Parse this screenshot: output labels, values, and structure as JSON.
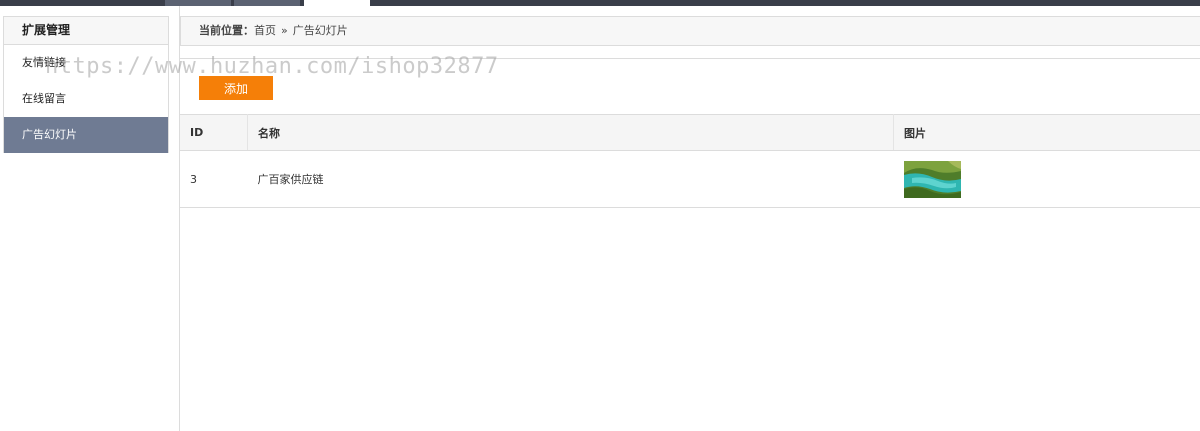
{
  "sidebar": {
    "title": "扩展管理",
    "items": [
      {
        "label": "友情链接"
      },
      {
        "label": "在线留言"
      },
      {
        "label": "广告幻灯片"
      }
    ]
  },
  "breadcrumb": {
    "label": "当前位置：",
    "home": "首页",
    "separator": "»",
    "current": "广告幻灯片"
  },
  "toolbar": {
    "add_label": "添加"
  },
  "table": {
    "columns": [
      "ID",
      "名称",
      "图片"
    ],
    "rows": [
      {
        "id": "3",
        "name": "广百家供应链"
      }
    ]
  },
  "watermark": "https://www.huzhan.com/ishop32877",
  "colors": {
    "accent": "#f57f08",
    "sidebar_active": "#6f7b93",
    "topbar": "#3a3e4a"
  }
}
